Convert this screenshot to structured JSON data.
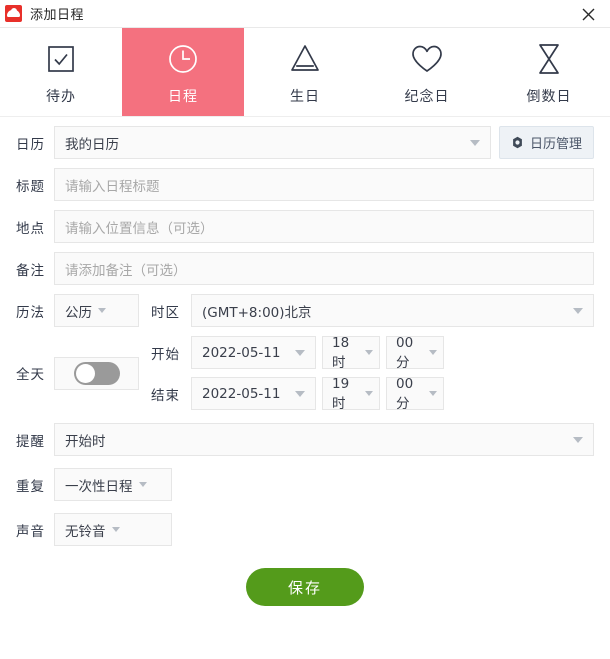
{
  "window": {
    "title": "添加日程",
    "app_icon": "cloud-icon",
    "close_icon": "close-icon"
  },
  "colors": {
    "accent_pink": "#f4717f",
    "save_green": "#549b1b",
    "app_icon_red": "#e8302a",
    "text_dark": "#333a4a"
  },
  "tabs": [
    {
      "label": "待办",
      "icon": "checkbox-icon",
      "active": false
    },
    {
      "label": "日程",
      "icon": "clock-icon",
      "active": true
    },
    {
      "label": "生日",
      "icon": "cake-icon",
      "active": false
    },
    {
      "label": "纪念日",
      "icon": "heart-icon",
      "active": false
    },
    {
      "label": "倒数日",
      "icon": "hourglass-icon",
      "active": false
    }
  ],
  "form": {
    "calendar": {
      "label": "日历",
      "value": "我的日历",
      "manage_button": "日历管理",
      "manage_icon": "gear-icon"
    },
    "title": {
      "label": "标题",
      "value": "",
      "placeholder": "请输入日程标题"
    },
    "location": {
      "label": "地点",
      "value": "",
      "placeholder": "请输入位置信息（可选）"
    },
    "note": {
      "label": "备注",
      "value": "",
      "placeholder": "请添加备注（可选）"
    },
    "calendar_system": {
      "label": "历法",
      "value": "公历"
    },
    "timezone": {
      "label": "时区",
      "value": "(GMT+8:00)北京"
    },
    "all_day": {
      "label": "全天",
      "enabled": false
    },
    "start": {
      "label": "开始",
      "date": "2022-05-11",
      "hour": "18时",
      "minute": "00分"
    },
    "end": {
      "label": "结束",
      "date": "2022-05-11",
      "hour": "19时",
      "minute": "00分"
    },
    "reminder": {
      "label": "提醒",
      "value": "开始时"
    },
    "repeat": {
      "label": "重复",
      "value": "一次性日程"
    },
    "sound": {
      "label": "声音",
      "value": "无铃音"
    }
  },
  "footer": {
    "save_label": "保存"
  }
}
